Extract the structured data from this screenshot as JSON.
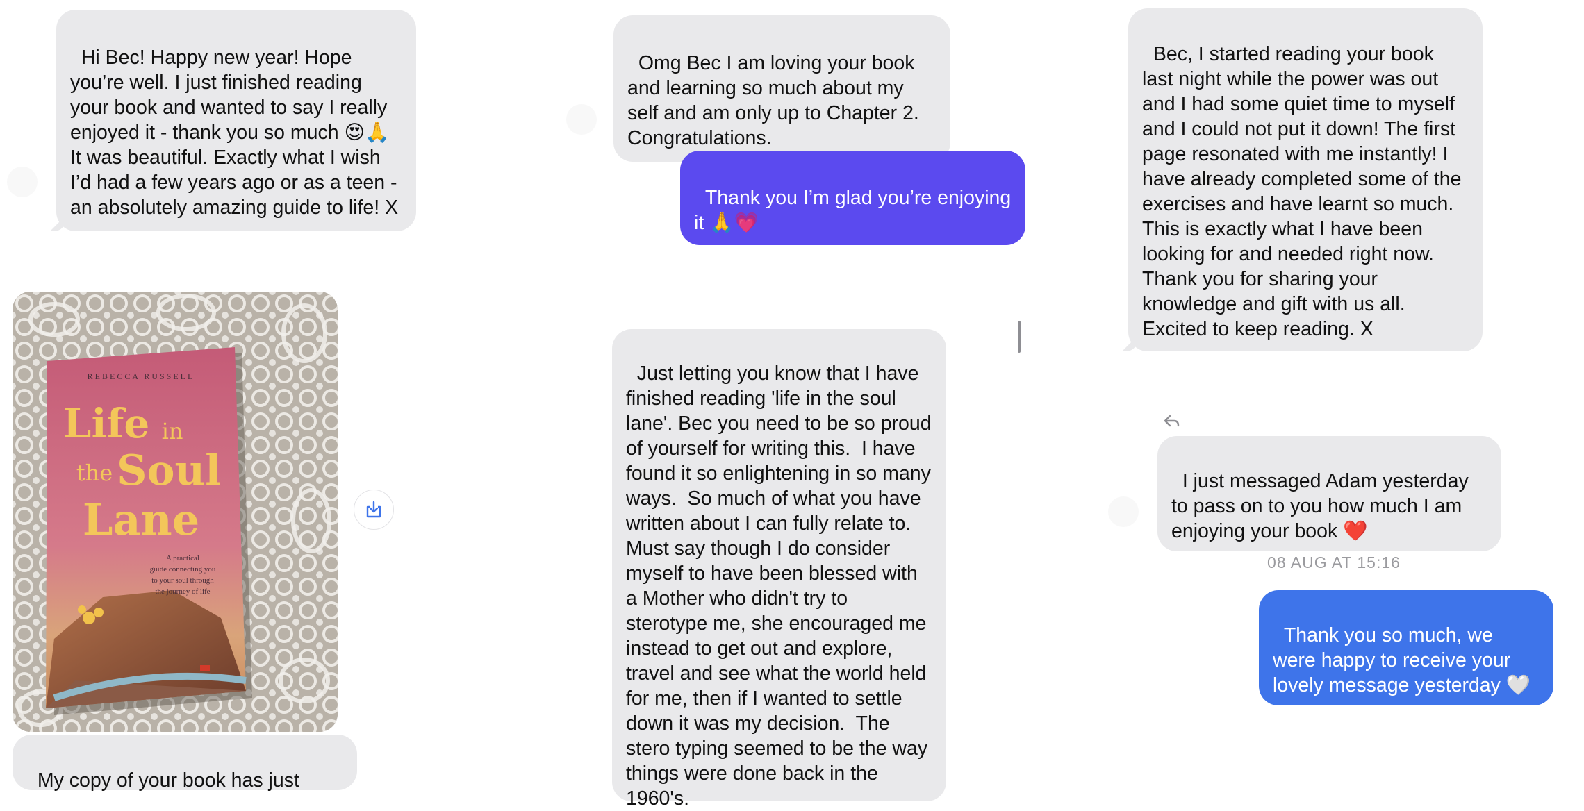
{
  "messages": {
    "col1_top": "Hi Bec! Happy new year! Hope you’re well. I just finished reading your book and wanted to say I really enjoyed it - thank you so much 😍🙏 It was beautiful. Exactly what I wish I’d had a few years ago or as a teen - an absolutely amazing guide to life! X",
    "col1_caption": "My copy of your book has just",
    "col2_top": "Omg Bec I am loving your book and learning so much about my self and am only up to Chapter 2. Congratulations.",
    "col2_reply": "Thank you I’m glad you’re enjoying it 🙏💗",
    "col2_long": "Just letting you know that I have finished reading 'life in the soul lane'. Bec you need to be so proud of yourself for writing this.  I have found it so enlightening in so many ways.  So much of what you have written about I can fully relate to.  Must say though I do consider myself to have been blessed with a Mother who didn't try to sterotype me, she encouraged me instead to get out and explore, travel and see what the world held for me, then if I wanted to settle down it was my decision.  The stero typing seemed to be the way things were done back in the 1960's.",
    "col3_top": "Bec, I started reading your book last night while the power was out and I had some quiet time to myself and I could not put it down! The first page resonated with me instantly! I have already completed some of the exercises and have learnt so much. This is exactly what I have been looking for and needed right now. Thank you for sharing your knowledge and gift with us all. Excited to keep reading. X",
    "col3_adam": "I just messaged Adam yesterday to pass on to you how much I am enjoying your book ❤️",
    "col3_reply": "Thank you so much, we were happy to receive your lovely message yesterday 🤍"
  },
  "timestamp": "08 AUG AT 15:16",
  "book": {
    "author": "REBECCA RUSSELL",
    "title_line1": "Life",
    "title_in": "in",
    "title_the": "the",
    "title_soul": "Soul",
    "title_lane": "Lane",
    "subtitle": "A practical guide connecting you to your soul through the journey of life"
  },
  "icons": {
    "download": "download-icon",
    "reply": "reply-arrow-icon"
  },
  "colors": {
    "received_bubble": "#e9e9eb",
    "sent_blue": "#3e74ea",
    "sent_purple": "#5b4aef",
    "timestamp": "#9b9b9f"
  }
}
